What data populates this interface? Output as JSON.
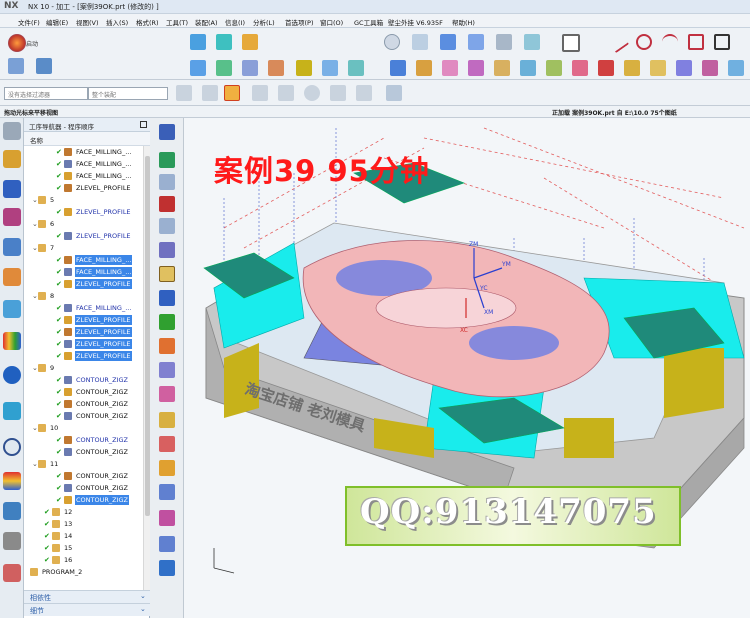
{
  "window": {
    "app_logo": "NX",
    "title": "NX 10 - 加工 - [案例39OK.prt  (修改的) ]"
  },
  "menu": [
    "文件(F)",
    "编辑(E)",
    "视图(V)",
    "插入(S)",
    "格式(R)",
    "工具(T)",
    "装配(A)",
    "信息(I)",
    "分析(L)",
    "首选项(P)",
    "窗口(O)",
    "GC工具箱",
    "壁尘外挂 V6.935F",
    "帮助(H)"
  ],
  "toolbar": {
    "start_label": "启动",
    "filter_placeholder": "没有选择过滤器",
    "assembly_placeholder": "整个装配"
  },
  "hints": {
    "left": "拖动光标来平移视图",
    "right": "正加载 案例39OK.prt 自 E:\\10.0  75个图纸"
  },
  "overlay": {
    "title": "案例39   95分钟",
    "qq": "QQ:913147075",
    "engraving": "淘宝店铺  老刘模具"
  },
  "navigator": {
    "title": "工序导航器 - 程序顺序",
    "column": "名称",
    "footer": [
      "相依性",
      "细节"
    ],
    "rows": [
      {
        "label": "FACE_MILLING_...",
        "level": 3,
        "check": true,
        "selected": false
      },
      {
        "label": "FACE_MILLING_...",
        "level": 3,
        "check": true,
        "selected": false
      },
      {
        "label": "FACE_MILLING_...",
        "level": 3,
        "check": true,
        "selected": false
      },
      {
        "label": "ZLEVEL_PROFILE",
        "level": 3,
        "check": true,
        "selected": false
      },
      {
        "label": "5",
        "level": 1,
        "check": false,
        "selected": false,
        "group": true
      },
      {
        "label": "ZLEVEL_PROFILE",
        "level": 2,
        "check": true,
        "selected": false,
        "prog": true
      },
      {
        "label": "6",
        "level": 1,
        "check": false,
        "selected": false,
        "group": true
      },
      {
        "label": "ZLEVEL_PROFILE",
        "level": 2,
        "check": true,
        "selected": false,
        "prog": true
      },
      {
        "label": "7",
        "level": 1,
        "check": false,
        "selected": false,
        "group": true
      },
      {
        "label": "FACE_MILLING_...",
        "level": 3,
        "check": true,
        "selected": true
      },
      {
        "label": "FACE_MILLING_...",
        "level": 3,
        "check": true,
        "selected": true
      },
      {
        "label": "ZLEVEL_PROFILE",
        "level": 3,
        "check": true,
        "selected": true
      },
      {
        "label": "8",
        "level": 1,
        "check": false,
        "selected": false,
        "group": true
      },
      {
        "label": "FACE_MILLING_...",
        "level": 2,
        "check": true,
        "selected": false,
        "prog": true
      },
      {
        "label": "ZLEVEL_PROFILE",
        "level": 3,
        "check": true,
        "selected": true
      },
      {
        "label": "ZLEVEL_PROFILE",
        "level": 3,
        "check": true,
        "selected": true
      },
      {
        "label": "ZLEVEL_PROFILE",
        "level": 3,
        "check": true,
        "selected": true
      },
      {
        "label": "ZLEVEL_PROFILE",
        "level": 3,
        "check": true,
        "selected": true
      },
      {
        "label": "9",
        "level": 1,
        "check": false,
        "selected": false,
        "group": true
      },
      {
        "label": "CONTOUR_ZIGZ",
        "level": 2,
        "check": true,
        "selected": false,
        "prog": true
      },
      {
        "label": "CONTOUR_ZIGZ",
        "level": 3,
        "check": true,
        "selected": false
      },
      {
        "label": "CONTOUR_ZIGZ",
        "level": 3,
        "check": true,
        "selected": false
      },
      {
        "label": "CONTOUR_ZIGZ",
        "level": 3,
        "check": true,
        "selected": false
      },
      {
        "label": "10",
        "level": 1,
        "check": false,
        "selected": false,
        "group": true
      },
      {
        "label": "CONTOUR_ZIGZ",
        "level": 2,
        "check": true,
        "selected": false,
        "prog": true
      },
      {
        "label": "CONTOUR_ZIGZ",
        "level": 3,
        "check": true,
        "selected": false
      },
      {
        "label": "11",
        "level": 1,
        "check": false,
        "selected": false,
        "group": true
      },
      {
        "label": "CONTOUR_ZIGZ",
        "level": 3,
        "check": true,
        "selected": false
      },
      {
        "label": "CONTOUR_ZIGZ",
        "level": 3,
        "check": true,
        "selected": false
      },
      {
        "label": "CONTOUR_ZIGZ",
        "level": 3,
        "check": true,
        "selected": true
      },
      {
        "label": "12",
        "level": 0,
        "check": true,
        "selected": false,
        "group": true
      },
      {
        "label": "13",
        "level": 0,
        "check": true,
        "selected": false,
        "group": true
      },
      {
        "label": "14",
        "level": 0,
        "check": true,
        "selected": false,
        "group": true
      },
      {
        "label": "15",
        "level": 0,
        "check": true,
        "selected": false,
        "group": true
      },
      {
        "label": "16",
        "level": 0,
        "check": true,
        "selected": false,
        "group": true
      },
      {
        "label": "PROGRAM_2",
        "level": -1,
        "check": false,
        "selected": false,
        "group": true
      }
    ]
  },
  "axis_labels": {
    "zm": "ZM",
    "ym": "YM",
    "xm": "XM",
    "xc": "XC",
    "yc": "YC"
  },
  "colors": {
    "cyan": "#19ecec",
    "teal": "#1f8a7a",
    "yellow": "#c7b21a",
    "pink": "#f2b6b8",
    "blue": "#7a84e0",
    "selection": "#3b86e8"
  }
}
